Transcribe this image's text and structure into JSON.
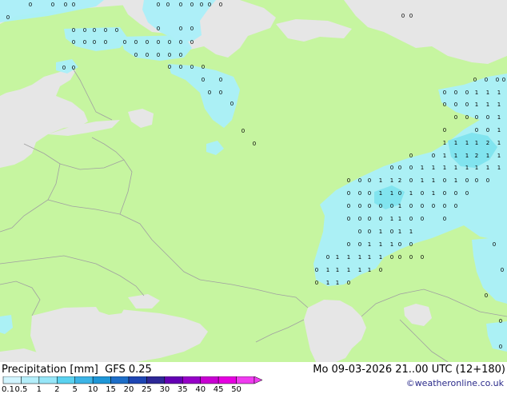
{
  "map": {
    "title": "Precipitation [mm]",
    "model": "GFS 0.25",
    "valid_time": "Mo 09-03-2026 21..00 UTC (12+180)",
    "credit": "©weatheronline.co.uk"
  },
  "legend": {
    "ticks": [
      "0.1",
      "0.5",
      "1",
      "2",
      "5",
      "10",
      "15",
      "20",
      "25",
      "30",
      "35",
      "40",
      "45",
      "50"
    ],
    "colors": [
      "#d2f5ff",
      "#b4eefa",
      "#96e6f8",
      "#5ad2f0",
      "#3cb4e6",
      "#1e96d7",
      "#1e6ec8",
      "#1e46b4",
      "#2d2896",
      "#6400b4",
      "#9600c8",
      "#c800d2",
      "#e600e1",
      "#f03cf0"
    ]
  },
  "palette": {
    "land": "#c6f5a0",
    "sea": "#e6e6e6",
    "precip_light": "#aaf0fa",
    "precip_medium": "#7ee4f4",
    "border": "#a0a0a0"
  },
  "markers": {
    "values": [
      "0",
      "1",
      "2"
    ]
  }
}
